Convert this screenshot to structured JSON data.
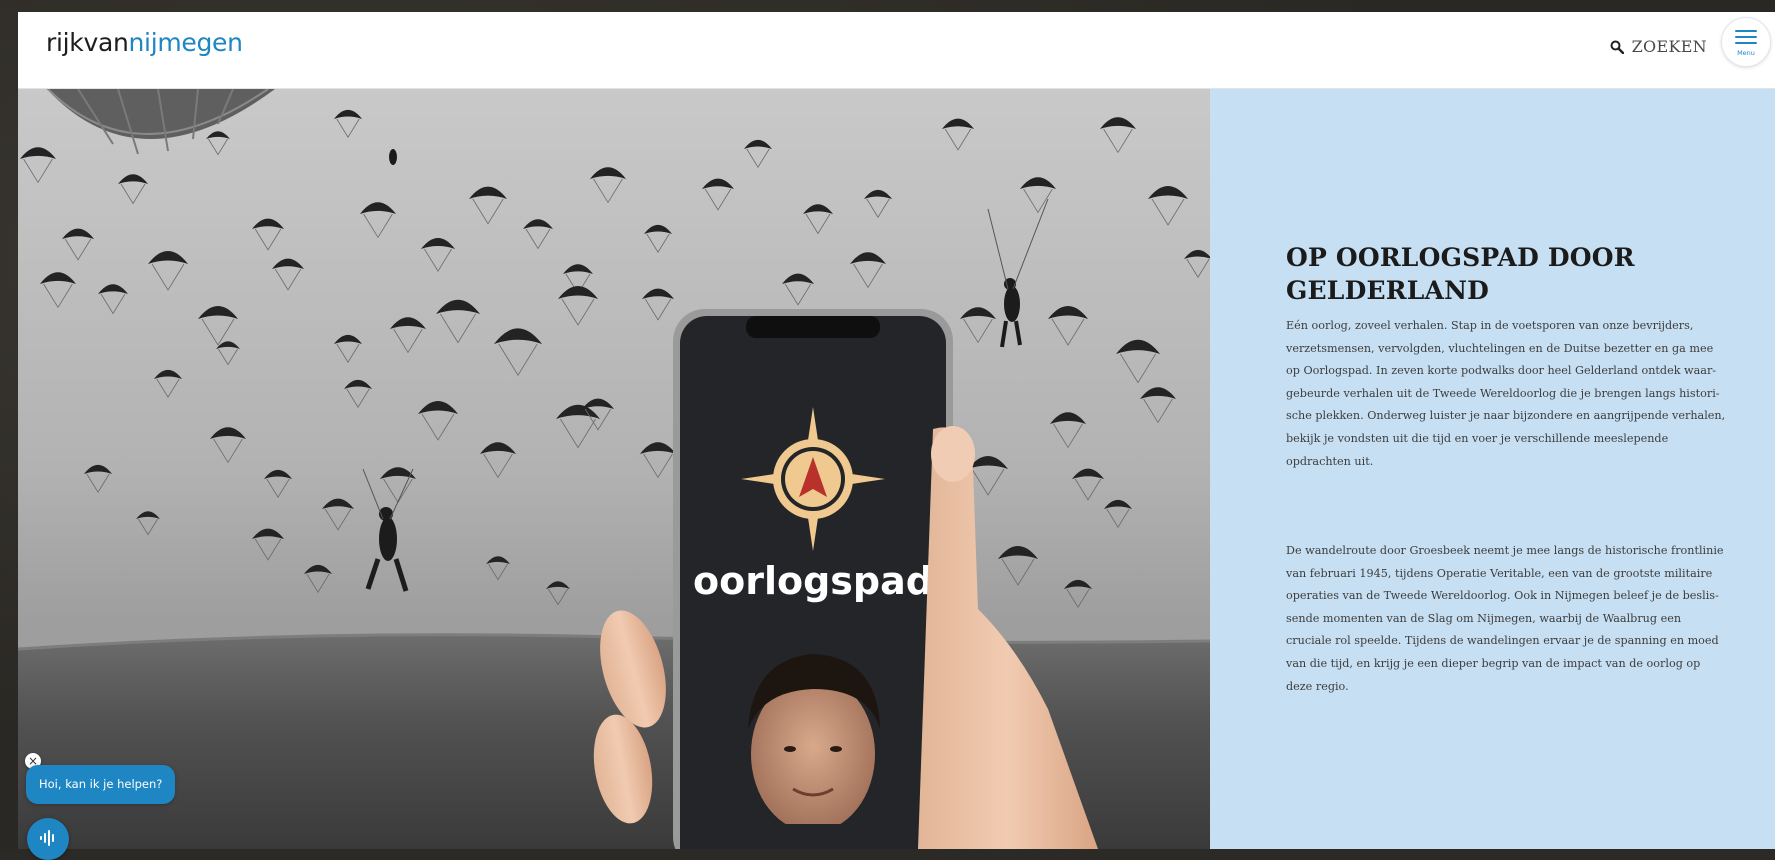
{
  "header": {
    "logo_part1": "rijkvan",
    "logo_part2": "nijmegen",
    "search_label": "ZOEKEN",
    "search_icon": "search-icon",
    "menu_label": "Menu",
    "menu_icon": "hamburger-icon"
  },
  "hero": {
    "app_name": "oorlogspad",
    "app_icon": "compass-icon"
  },
  "info": {
    "title": "OP OORLOGSPAD DOOR GELDERLAND",
    "paragraph1": "Eén oorlog, zoveel verhalen. Stap in de voetsporen van onze bevrijders, verzetsmensen, vervolgden, vluchtelingen en de Duitse bezetter en ga mee op Oorlogspad. In zeven korte podwalks door heel Gelderland ontdek waar-gebeurde verhalen uit de Tweede Wereldoorlog die je brengen langs histori-sche plekken. Onderweg luister je naar bijzondere en aangrijpende verhalen, bekijk je vondsten uit die tijd en voer je verschillende meeslepende opdrachten uit.",
    "paragraph2": "De wandelroute door Groesbeek neemt je mee langs de historische frontlinie van februari 1945, tijdens Operatie Veritable, een van de grootste militaire operaties van de Tweede Wereldoorlog. Ook in Nijmegen beleef je de beslis-sende momenten van de Slag om Nijmegen, waarbij de Waalbrug een cruciale rol speelde. Tijdens de wandelingen ervaar je de spanning en moed van die tijd, en krijg je een dieper begrip van de impact van de oorlog op deze regio."
  },
  "chat": {
    "close_label": "×",
    "greeting": "Hoi, kan ik je helpen?",
    "launcher_icon": "audio-wave-icon"
  },
  "colors": {
    "brand_blue": "#1f86c4",
    "panel_bg": "#c6dff2",
    "phone_screen": "#232528",
    "compass_accent": "#efc98f",
    "compass_needle": "#b8312b"
  }
}
